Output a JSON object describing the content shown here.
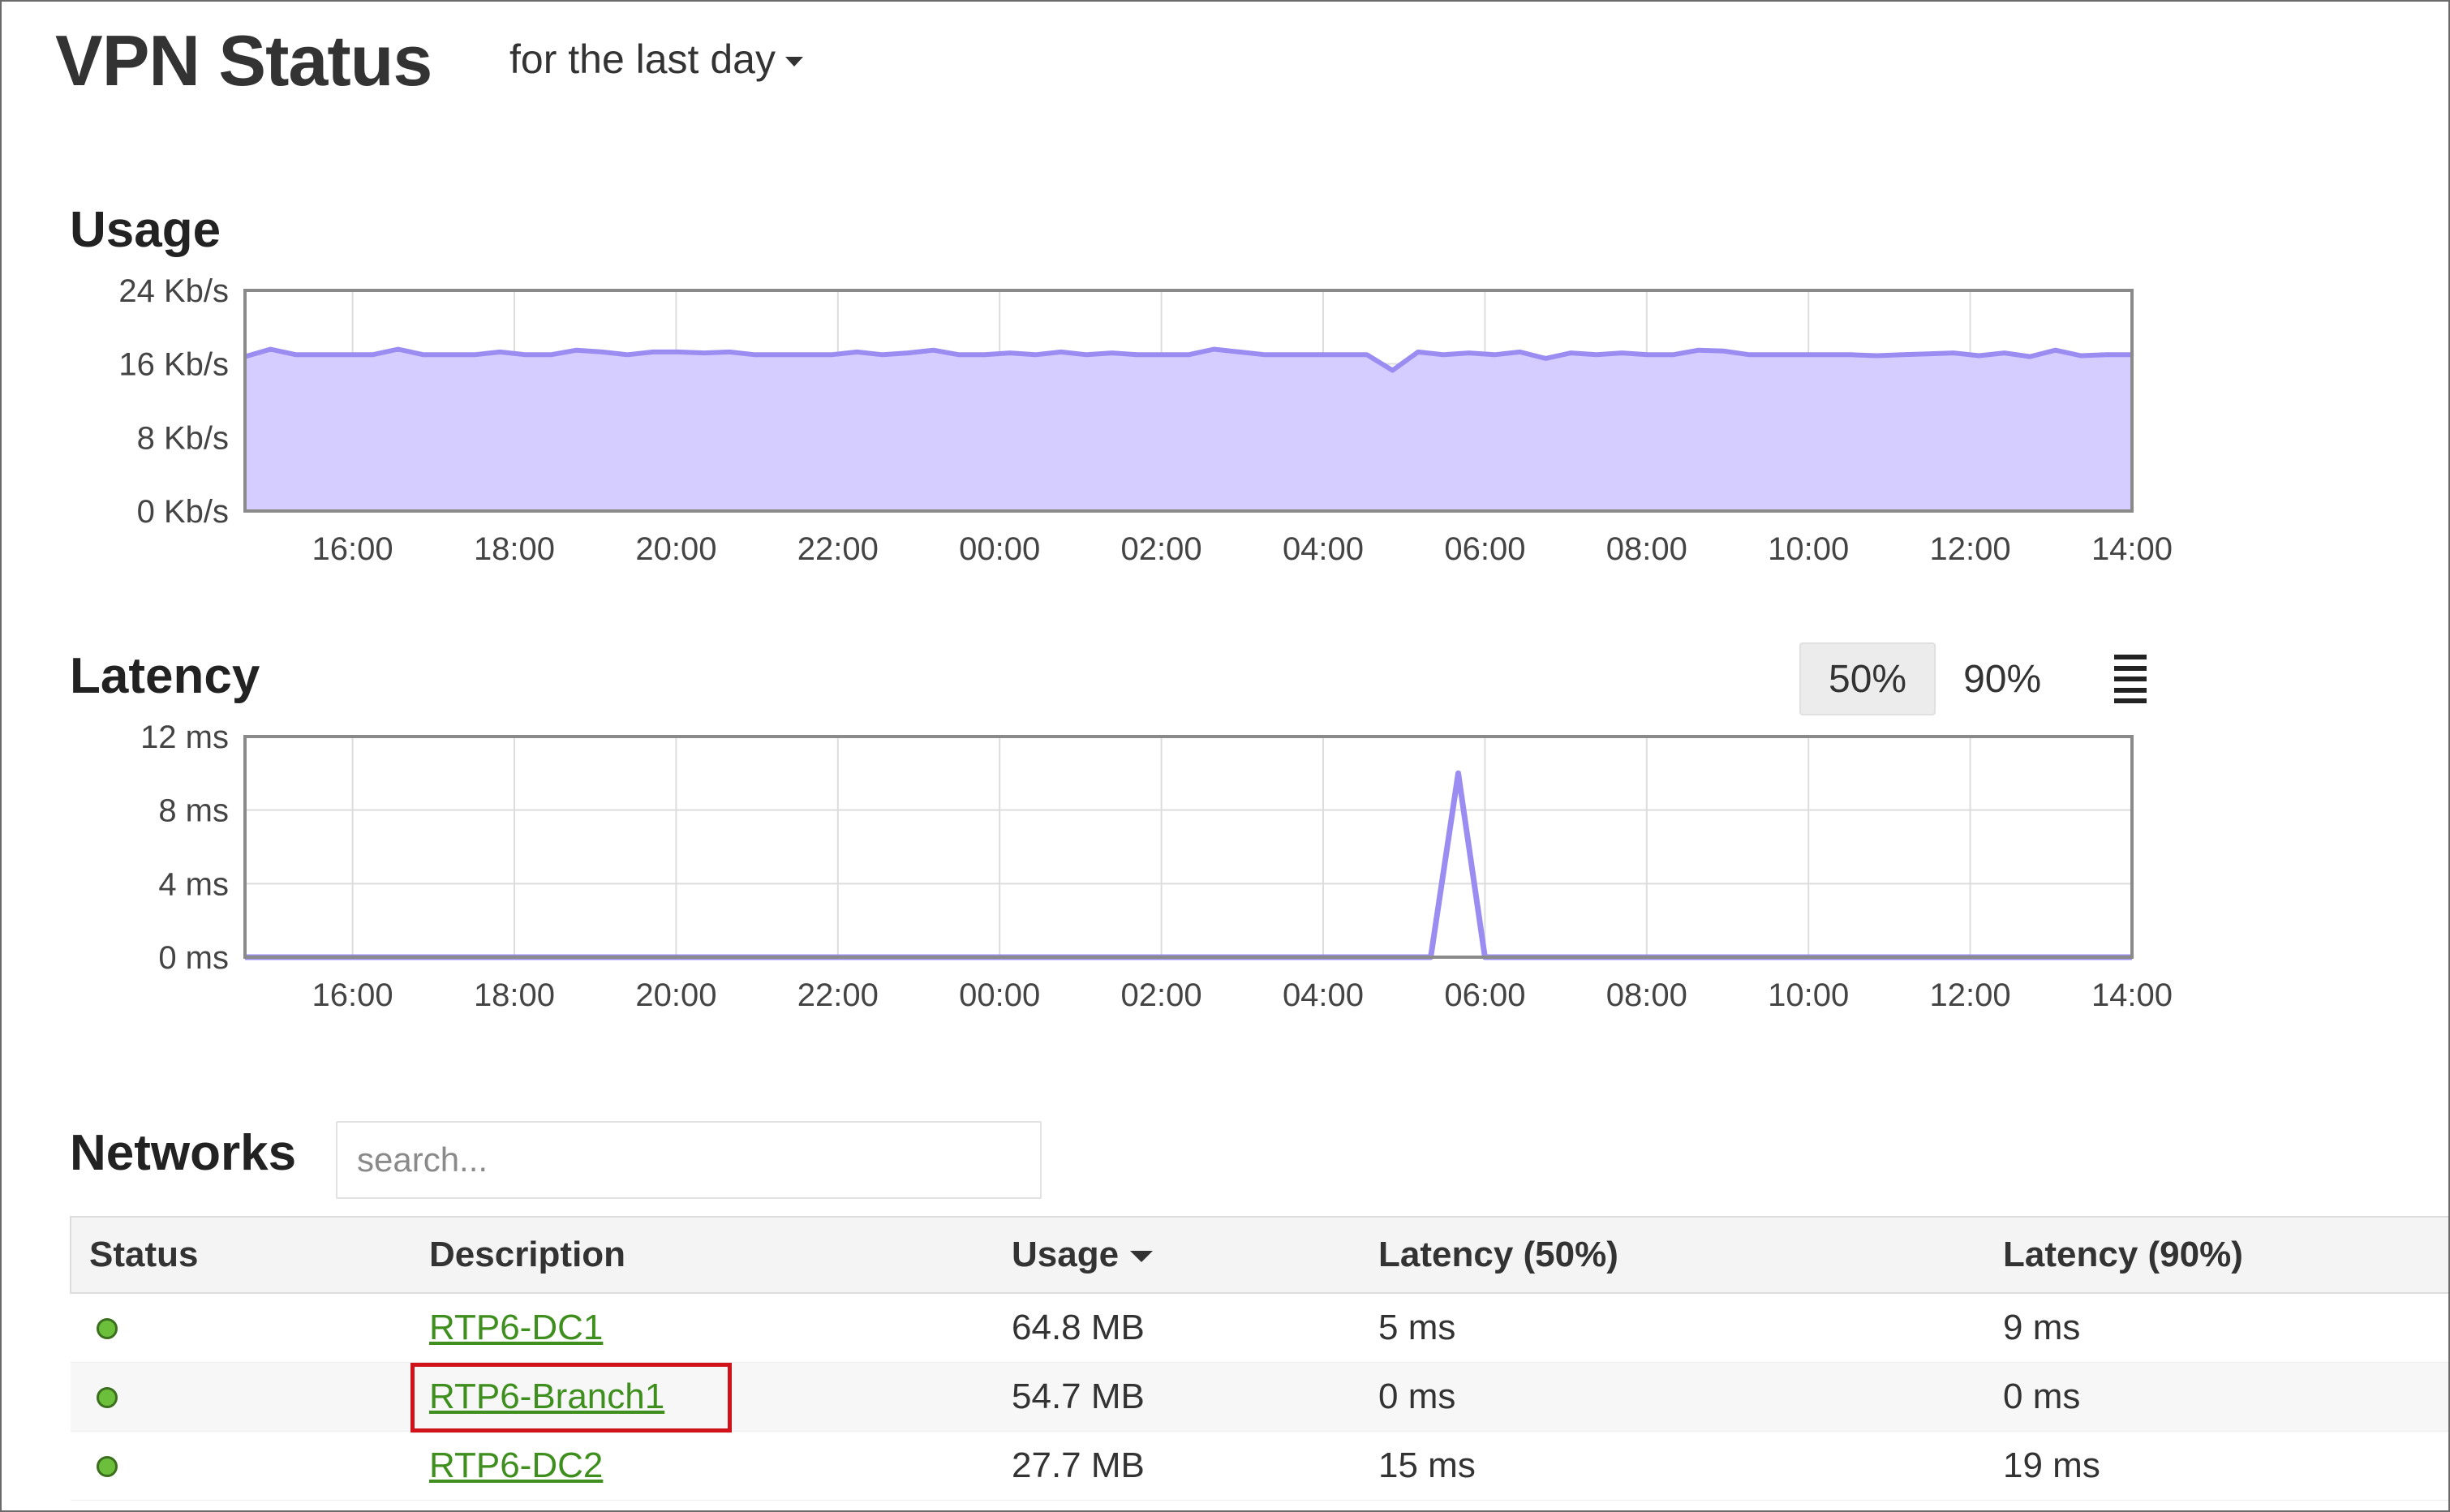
{
  "header": {
    "title": "VPN Status",
    "time_range": "for the last day"
  },
  "colors": {
    "series_fill": "#d5ccff",
    "series_line": "#9b8cf2",
    "link": "#3f8f1f",
    "status_ok": "#6bbf3a",
    "highlight": "#d0121b"
  },
  "chart_data": [
    {
      "type": "area",
      "title": "Usage",
      "xlabel": "",
      "ylabel": "",
      "x_ticks": [
        "16:00",
        "18:00",
        "20:00",
        "22:00",
        "00:00",
        "02:00",
        "04:00",
        "06:00",
        "08:00",
        "10:00",
        "12:00",
        "14:00"
      ],
      "y_ticks": [
        "0 Kb/s",
        "8 Kb/s",
        "16 Kb/s",
        "24 Kb/s"
      ],
      "ylim": [
        0,
        24
      ],
      "x_range_hours": [
        14.67,
        14.0
      ],
      "grid": true,
      "series": [
        {
          "values": [
            16.8,
            17.6,
            17.0,
            17.0,
            17.0,
            17.0,
            17.6,
            17.0,
            17.0,
            17.0,
            17.3,
            17.0,
            17.0,
            17.5,
            17.3,
            17.0,
            17.3,
            17.3,
            17.2,
            17.3,
            17.0,
            17.0,
            17.0,
            17.0,
            17.3,
            17.0,
            17.2,
            17.5,
            17.0,
            17.0,
            17.2,
            17.0,
            17.3,
            17.0,
            17.2,
            17.0,
            17.0,
            17.0,
            17.6,
            17.3,
            17.0,
            17.0,
            17.0,
            17.0,
            17.0,
            15.3,
            17.3,
            17.0,
            17.2,
            17.0,
            17.3,
            16.6,
            17.2,
            17.0,
            17.2,
            17.0,
            17.0,
            17.5,
            17.4,
            17.0,
            17.0,
            17.0,
            17.0,
            17.0,
            16.9,
            17.0,
            17.1,
            17.2,
            16.9,
            17.2,
            16.8,
            17.5,
            16.9,
            17.0,
            17.0
          ]
        }
      ]
    },
    {
      "type": "line",
      "title": "Latency",
      "xlabel": "",
      "ylabel": "",
      "x_ticks": [
        "16:00",
        "18:00",
        "20:00",
        "22:00",
        "00:00",
        "02:00",
        "04:00",
        "06:00",
        "08:00",
        "10:00",
        "12:00",
        "14:00"
      ],
      "y_ticks": [
        "0 ms",
        "4 ms",
        "8 ms",
        "12 ms"
      ],
      "ylim": [
        0,
        12
      ],
      "grid": true,
      "series": [
        {
          "points": [
            [
              14.67,
              0
            ],
            [
              5.33,
              0
            ],
            [
              5.67,
              10
            ],
            [
              6.0,
              0
            ],
            [
              14.0,
              0
            ]
          ]
        }
      ]
    }
  ],
  "latency": {
    "percentile_options": [
      "50%",
      "90%"
    ],
    "selected": "50%"
  },
  "networks": {
    "title": "Networks",
    "search_placeholder": "search...",
    "search_value": "",
    "columns": [
      "Status",
      "Description",
      "Usage",
      "Latency (50%)",
      "Latency (90%)"
    ],
    "sorted_by": "Usage",
    "rows": [
      {
        "description": "RTP6-DC1",
        "usage": "64.8 MB",
        "latency50": "5 ms",
        "latency90": "9 ms"
      },
      {
        "description": "RTP6-Branch1",
        "usage": "54.7 MB",
        "latency50": "0 ms",
        "latency90": "0 ms"
      },
      {
        "description": "RTP6-DC2",
        "usage": "27.7 MB",
        "latency50": "15 ms",
        "latency90": "19 ms"
      }
    ]
  }
}
